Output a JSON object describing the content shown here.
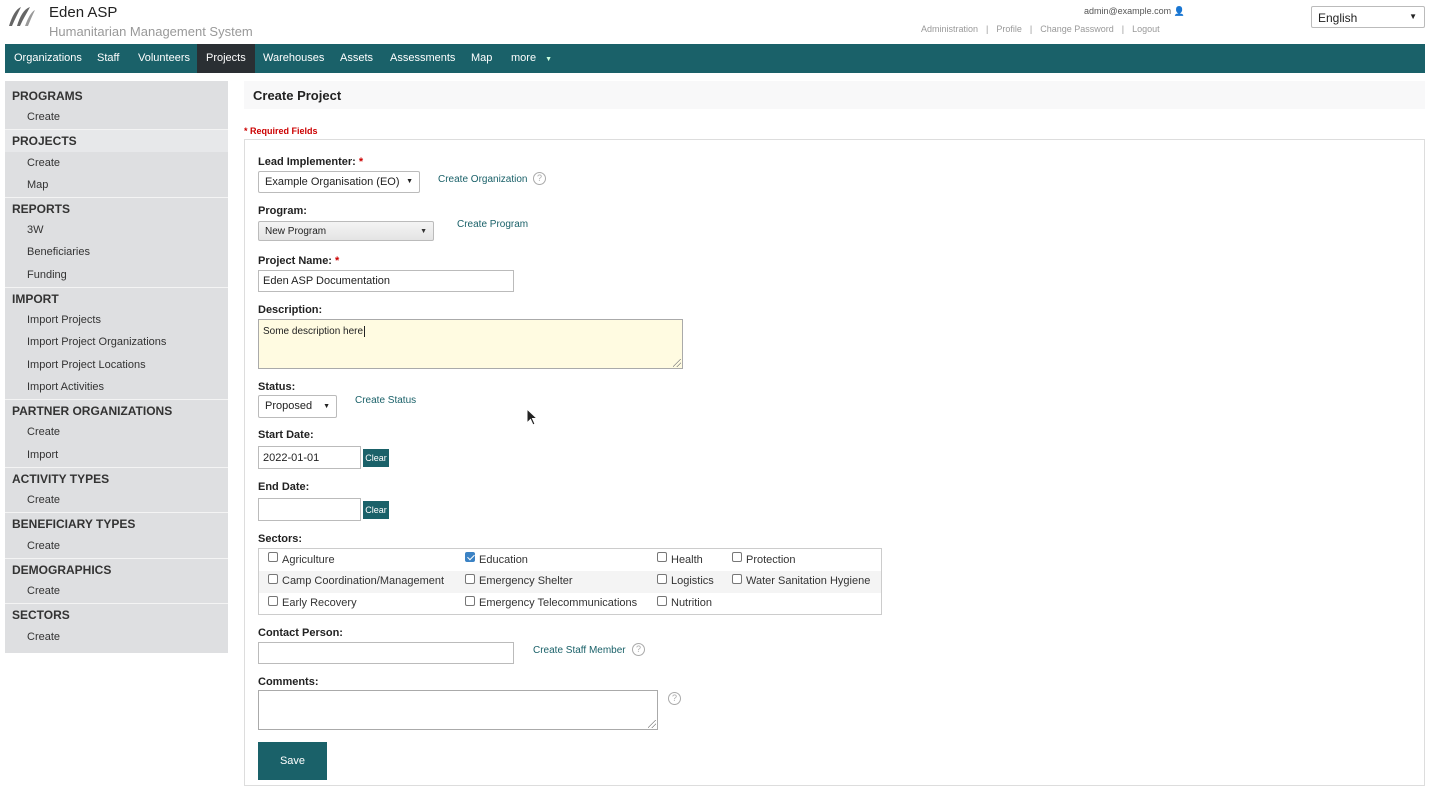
{
  "header": {
    "app_name": "Eden ASP",
    "app_subtitle": "Humanitarian Management System",
    "user_email": "admin@example.com",
    "links": [
      "Administration",
      "Profile",
      "Change Password",
      "Logout"
    ],
    "language": "English"
  },
  "nav": {
    "items": [
      "Organizations",
      "Staff",
      "Volunteers",
      "Projects",
      "Warehouses",
      "Assets",
      "Assessments",
      "Map",
      "more"
    ],
    "active": "Projects"
  },
  "sidebar": {
    "sections": [
      {
        "title": "PROGRAMS",
        "items": [
          "Create"
        ]
      },
      {
        "title": "PROJECTS",
        "items": [
          "Create",
          "Map"
        ]
      },
      {
        "title": "REPORTS",
        "items": [
          "3W",
          "Beneficiaries",
          "Funding"
        ]
      },
      {
        "title": "IMPORT",
        "items": [
          "Import Projects",
          "Import Project Organizations",
          "Import Project Locations",
          "Import Activities"
        ]
      },
      {
        "title": "PARTNER ORGANIZATIONS",
        "items": [
          "Create",
          "Import"
        ]
      },
      {
        "title": "ACTIVITY TYPES",
        "items": [
          "Create"
        ]
      },
      {
        "title": "BENEFICIARY TYPES",
        "items": [
          "Create"
        ]
      },
      {
        "title": "DEMOGRAPHICS",
        "items": [
          "Create"
        ]
      },
      {
        "title": "SECTORS",
        "items": [
          "Create"
        ]
      }
    ]
  },
  "main": {
    "title": "Create Project",
    "required_note": "* Required Fields",
    "required_star": "*",
    "lead_implementer": {
      "label": "Lead Implementer:",
      "value": "Example Organisation (EO)",
      "create_link": "Create Organization"
    },
    "program": {
      "label": "Program:",
      "value": "New Program",
      "create_link": "Create Program"
    },
    "project_name": {
      "label": "Project Name:",
      "value": "Eden ASP Documentation"
    },
    "description": {
      "label": "Description:",
      "value": "Some description here"
    },
    "status": {
      "label": "Status:",
      "value": "Proposed",
      "create_link": "Create Status"
    },
    "start_date": {
      "label": "Start Date:",
      "value": "2022-01-01",
      "clear": "Clear"
    },
    "end_date": {
      "label": "End Date:",
      "value": "",
      "clear": "Clear"
    },
    "sectors": {
      "label": "Sectors:",
      "items": [
        {
          "name": "Agriculture",
          "checked": false
        },
        {
          "name": "Education",
          "checked": true
        },
        {
          "name": "Health",
          "checked": false
        },
        {
          "name": "Protection",
          "checked": false
        },
        {
          "name": "Camp Coordination/Management",
          "checked": false
        },
        {
          "name": "Emergency Shelter",
          "checked": false
        },
        {
          "name": "Logistics",
          "checked": false
        },
        {
          "name": "Water Sanitation Hygiene",
          "checked": false
        },
        {
          "name": "Early Recovery",
          "checked": false
        },
        {
          "name": "Emergency Telecommunications",
          "checked": false
        },
        {
          "name": "Nutrition",
          "checked": false
        }
      ]
    },
    "contact_person": {
      "label": "Contact Person:",
      "value": "",
      "create_link": "Create Staff Member"
    },
    "comments": {
      "label": "Comments:",
      "value": ""
    },
    "help_glyph": "?",
    "save_label": "Save"
  },
  "colors": {
    "brand": "#1a6169",
    "active_nav": "#2a2f33",
    "required": "#cc0000",
    "checkbox": "#3b82c4"
  }
}
